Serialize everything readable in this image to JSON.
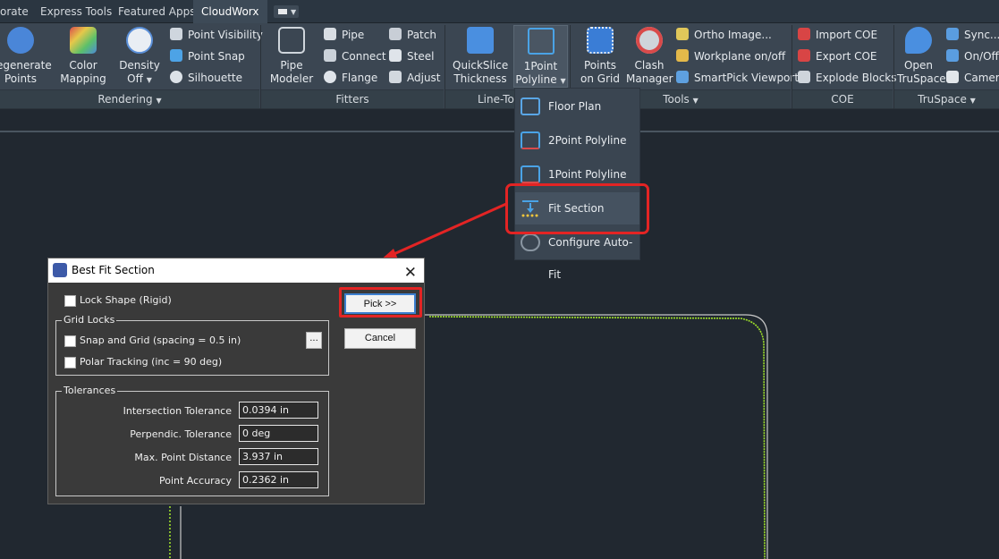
{
  "tabs": [
    "orate",
    "Express Tools",
    "Featured Apps",
    "CloudWorx"
  ],
  "ribbon": {
    "rendering": {
      "regenerate": [
        "egenerate",
        "Points"
      ],
      "color_mapping": [
        "Color",
        "Mapping"
      ],
      "density": [
        "Density",
        "Off"
      ],
      "point_visibility": "Point Visibility",
      "point_snap": "Point Snap",
      "silhouette": "Silhouette",
      "panel": "Rendering"
    },
    "fitters": {
      "pipe_modeler": [
        "Pipe",
        "Modeler"
      ],
      "pipe": "Pipe",
      "connect": "Connect",
      "flange": "Flange",
      "patch": "Patch",
      "steel": "Steel",
      "adjust": "Adjust",
      "panel": "Fitters"
    },
    "linetools": {
      "quickslice": [
        "QuickSlice",
        "Thickness"
      ],
      "onepoint": [
        "1Point",
        "Polyline"
      ],
      "panel": "Line-Too"
    },
    "tools": {
      "points_on_grid": [
        "Points",
        "on Grid"
      ],
      "clash_manager": [
        "Clash",
        "Manager"
      ],
      "ortho_image": "Ortho Image...",
      "workplane": "Workplane on/off",
      "smartpick": "SmartPick Viewport",
      "panel": "Tools"
    },
    "coe": {
      "import": "Import COE",
      "export": "Export COE",
      "explode": "Explode Blocks",
      "panel": "COE"
    },
    "truspace": {
      "open": [
        "Open",
        "TruSpace"
      ],
      "sync": "Sync...",
      "onoff": "On/Off",
      "camera": "Camera",
      "panel": "TruSpace"
    }
  },
  "dropdown": {
    "items": [
      "Floor Plan",
      "2Point Polyline",
      "1Point Polyline",
      "Fit Section",
      "Configure Auto-Fit"
    ]
  },
  "dialog": {
    "title": "Best Fit Section",
    "close": "✕",
    "lock_shape": "Lock Shape (Rigid)",
    "grid_locks_title": "Grid Locks",
    "snap_grid": "Snap and Grid (spacing = 0.5 in)",
    "polar_tracking": "Polar Tracking (inc = 90 deg)",
    "ellipsis": "...",
    "tolerances_title": "Tolerances",
    "tolerances": [
      {
        "label": "Intersection Tolerance",
        "value": "0.0394 in"
      },
      {
        "label": "Perpendic. Tolerance",
        "value": "0 deg"
      },
      {
        "label": "Max. Point Distance",
        "value": "3.937 in"
      },
      {
        "label": "Point Accuracy",
        "value": "0.2362 in"
      }
    ],
    "pick": "Pick  >>",
    "cancel": "Cancel"
  },
  "colors": {
    "highlight": "#e32424",
    "point_cloud": "#9ee02a",
    "ribbon": "#3b4652"
  }
}
